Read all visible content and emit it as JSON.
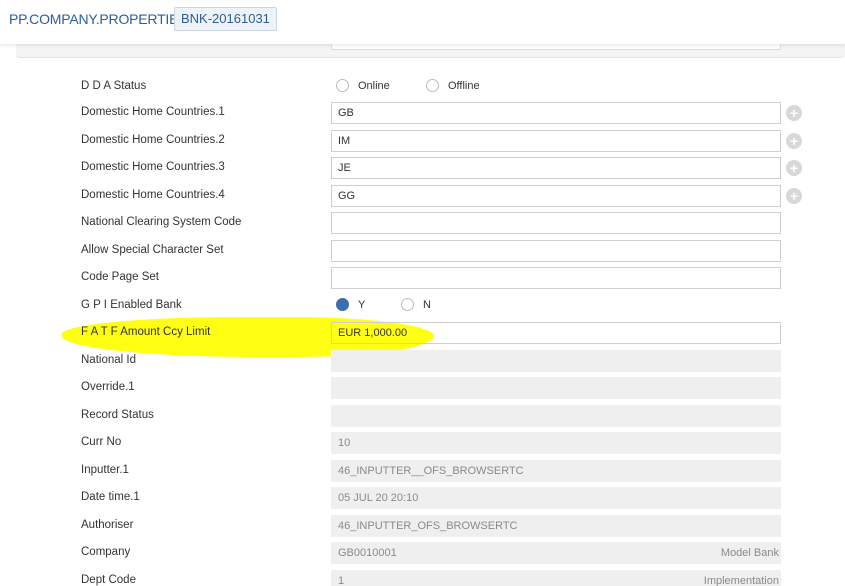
{
  "header": {
    "title": "PP.COMPANY.PROPERTIES",
    "record_id": "BNK-20161031"
  },
  "colors": {
    "accent": "#2d5d9a",
    "highlight": "#ffff00",
    "radio_selected": "#3b6fb0"
  },
  "dda": {
    "label": "D D A Status",
    "options": [
      "Online",
      "Offline"
    ]
  },
  "domestic": [
    {
      "label": "Domestic Home Countries.1",
      "value": "GB"
    },
    {
      "label": "Domestic Home Countries.2",
      "value": "IM"
    },
    {
      "label": "Domestic Home Countries.3",
      "value": "JE"
    },
    {
      "label": "Domestic Home Countries.4",
      "value": "GG"
    }
  ],
  "editable": [
    {
      "label": "National Clearing System Code",
      "value": ""
    },
    {
      "label": "Allow Special Character Set",
      "value": ""
    },
    {
      "label": "Code Page Set",
      "value": ""
    }
  ],
  "gpi": {
    "label": "G P I Enabled Bank",
    "options": [
      "Y",
      "N"
    ],
    "selected": "Y"
  },
  "fatf": {
    "label": "F A T F Amount Ccy Limit",
    "value": "EUR 1,000.00"
  },
  "readonly": [
    {
      "label": "National Id",
      "value": "",
      "right": ""
    },
    {
      "label": "Override.1",
      "value": "",
      "right": ""
    },
    {
      "label": "Record Status",
      "value": "",
      "right": ""
    },
    {
      "label": "Curr No",
      "value": "10",
      "right": ""
    },
    {
      "label": "Inputter.1",
      "value": "46_INPUTTER__OFS_BROWSERTC",
      "right": ""
    },
    {
      "label": "Date time.1",
      "value": "05 JUL 20 20:10",
      "right": ""
    },
    {
      "label": "Authoriser",
      "value": "46_INPUTTER_OFS_BROWSERTC",
      "right": ""
    },
    {
      "label": "Company",
      "value": "GB0010001",
      "right": "Model Bank"
    },
    {
      "label": "Dept Code",
      "value": "1",
      "right": "Implementation"
    }
  ]
}
